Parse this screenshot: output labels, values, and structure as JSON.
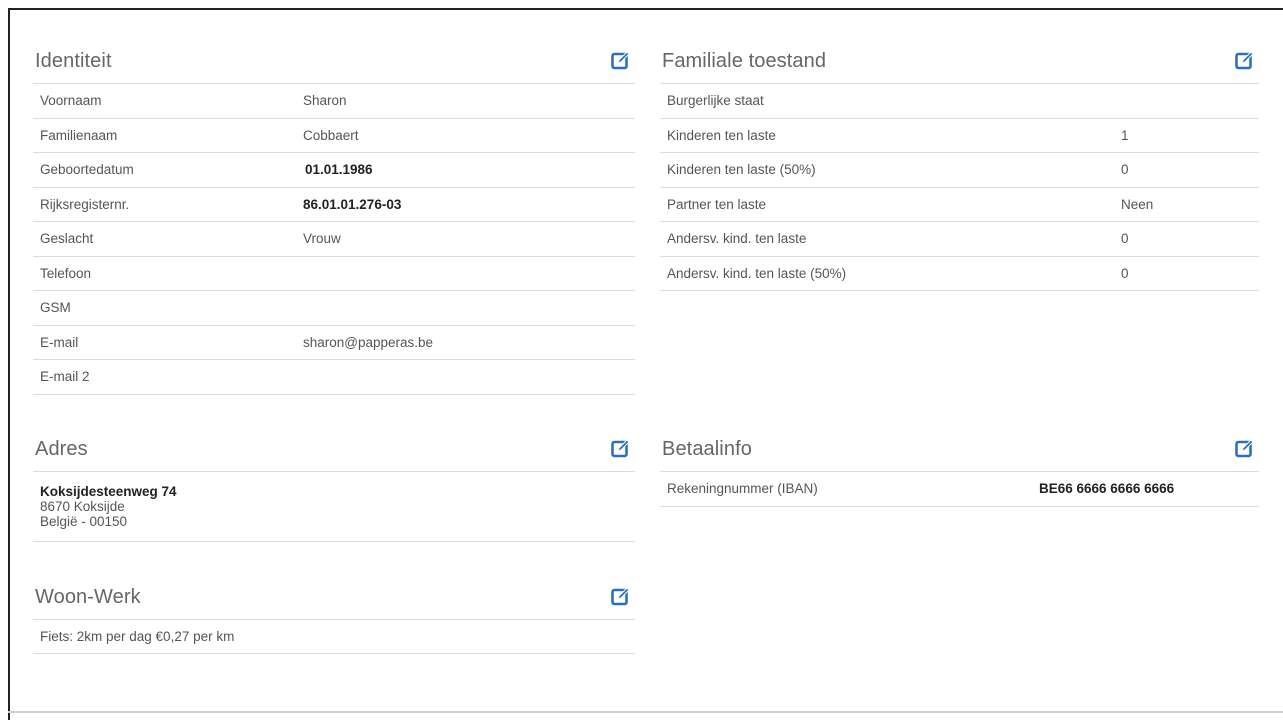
{
  "identiteit": {
    "title": "Identiteit",
    "rows": [
      {
        "label": "Voornaam",
        "value": "Sharon"
      },
      {
        "label": "Familienaam",
        "value": "Cobbaert"
      },
      {
        "label": "Geboortedatum",
        "value": "01.01.1986"
      },
      {
        "label": "Rijksregisternr.",
        "value": "86.01.01.276-03"
      },
      {
        "label": "Geslacht",
        "value": "Vrouw"
      },
      {
        "label": "Telefoon",
        "value": ""
      },
      {
        "label": "GSM",
        "value": ""
      },
      {
        "label": "E-mail",
        "value": "sharon@papperas.be"
      },
      {
        "label": "E-mail 2",
        "value": ""
      }
    ]
  },
  "familiale": {
    "title": "Familiale toestand",
    "rows": [
      {
        "label": "Burgerlijke staat",
        "value": ""
      },
      {
        "label": "Kinderen ten laste",
        "value": "1"
      },
      {
        "label": "Kinderen ten laste (50%)",
        "value": "0"
      },
      {
        "label": "Partner ten laste",
        "value": "Neen"
      },
      {
        "label": "Andersv. kind. ten laste",
        "value": "0"
      },
      {
        "label": "Andersv. kind. ten laste (50%)",
        "value": "0"
      }
    ]
  },
  "adres": {
    "title": "Adres",
    "street": "Koksijdesteenweg 74",
    "city": "8670 Koksijde",
    "country": "België - 00150"
  },
  "betaalinfo": {
    "title": "Betaalinfo",
    "rows": [
      {
        "label": "Rekeningnummer (IBAN)",
        "value": "BE66 6666 6666 6666"
      }
    ]
  },
  "woonwerk": {
    "title": "Woon-Werk",
    "text": "Fiets: 2km per dag €0,27 per km"
  },
  "icons": {
    "edit": "edit-icon"
  },
  "colors": {
    "accent": "#2b6fc4"
  }
}
